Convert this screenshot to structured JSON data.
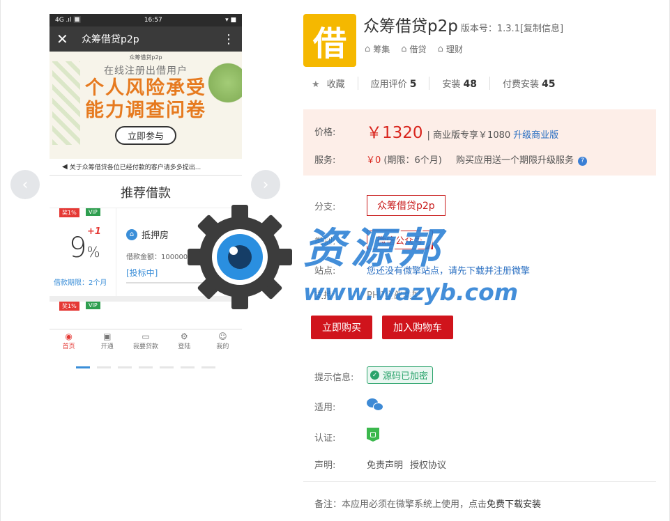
{
  "phone": {
    "status_left": "4G .ıl 🔲",
    "status_time": "16:57",
    "status_right": "▾ ■",
    "title": "众筹借贷p2p",
    "banner_brand": "众筹借贷p2p",
    "banner_sub": "在线注册出借用户",
    "banner_line1": "个人风险承受",
    "banner_line2": "能力调查问卷",
    "banner_btn": "立即参与",
    "notice": "关于众筹借贷各位已经付款的客户请多多提出...",
    "recommend_title": "推荐借款",
    "loan": {
      "tag_award": "奖1%",
      "tag_vip": "VIP",
      "plus": "+1",
      "rate": "9",
      "rate_unit": "%",
      "term": "借款期限：2个月",
      "type": "抵押房",
      "amount": "借款金额：100000.00元",
      "status": "[投标中]"
    },
    "loan2": {
      "tag_award": "奖1%",
      "tag_vip": "VIP"
    },
    "tabs": [
      {
        "label": "首页",
        "icon": "home-icon"
      },
      {
        "label": "开通",
        "icon": "wallet-icon"
      },
      {
        "label": "我要贷款",
        "icon": "loan-icon"
      },
      {
        "label": "登陆",
        "icon": "gear-icon"
      },
      {
        "label": "我的",
        "icon": "user-icon"
      }
    ]
  },
  "gallery": {
    "prev": "‹",
    "next": "›",
    "slide_count": 7,
    "active_index": 0
  },
  "app": {
    "icon_glyph": "借",
    "name": "众筹借贷p2p",
    "version": "版本号：1.3.1[复制信息]",
    "tags": [
      "筹集",
      "借贷",
      "理财"
    ],
    "favorite": "收藏",
    "rating_label": "应用评价",
    "rating": "5",
    "installs_label": "安装",
    "installs": "48",
    "paid_label": "付费安装",
    "paid": "45"
  },
  "pricing": {
    "price_label": "价格:",
    "price": "￥1320",
    "biz_text": "| 商业版专享￥1080",
    "upgrade_link": "升级商业版",
    "service_label": "服务:",
    "service_price": "￥0",
    "service_period": "(期限：6个月)",
    "service_promo": "购买应用送一个期限升级服务",
    "help": "?"
  },
  "details": {
    "branch_label": "分支:",
    "branch_value": "众筹借贷p2p",
    "type_label": "类别:",
    "type_value": "微信公众号",
    "site_label": "站点:",
    "site_value": "您还没有微擎站点，请先下载并注册微擎",
    "support_label": "支持:",
    "support_value": "PHP全部类型"
  },
  "actions": {
    "buy": "立即购买",
    "cart": "加入购物车"
  },
  "meta": {
    "hint_label": "提示信息:",
    "hint_value": "源码已加密",
    "fit_label": "适用:",
    "cert_label": "认证:",
    "statement_label": "声明:",
    "disclaimer": "免责声明",
    "license": "授权协议"
  },
  "note": {
    "prefix": "备注：本应用必须在微擎系统上使用，点击",
    "link": "免费下载安装"
  },
  "watermark": {
    "text": "资源邦",
    "url": "www.wazyb.com"
  },
  "colors": {
    "accent_red": "#d0141c",
    "link_blue": "#2a6fc2",
    "price_bg": "#fdeee8",
    "icon_yellow": "#f5b800"
  }
}
